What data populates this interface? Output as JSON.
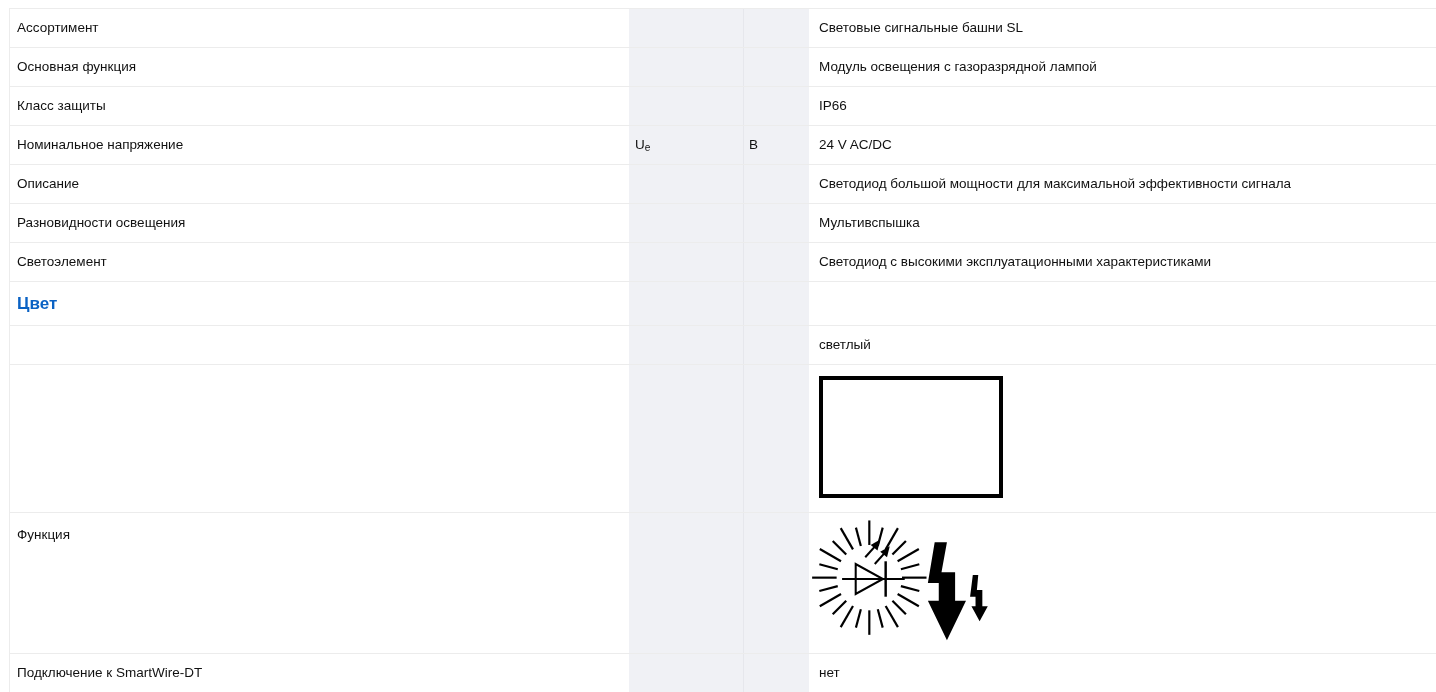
{
  "rows": [
    {
      "kind": "text",
      "label": "Ассортимент",
      "value": "Световые сигнальные башни SL"
    },
    {
      "kind": "text",
      "label": "Основная функция",
      "value": "Модуль освещения с газоразрядной лампой"
    },
    {
      "kind": "text",
      "label": "Класс защиты",
      "value": "IP66"
    },
    {
      "kind": "text",
      "label": "Номинальное напряжение",
      "symbol": "U$_{e}$",
      "unit": "В",
      "value": "24 V AC/DC"
    },
    {
      "kind": "text",
      "label": "Описание",
      "value": "Светодиод большой мощности для максимальной эффективности сигнала"
    },
    {
      "kind": "text",
      "label": "Разновидности освещения",
      "value": "Мультивспышка"
    },
    {
      "kind": "text",
      "label": "Светоэлемент",
      "value": "Светодиод с высокими эксплуатационными характеристиками"
    },
    {
      "kind": "heading",
      "label": "Цвет"
    },
    {
      "kind": "text",
      "value": "светлый"
    },
    {
      "kind": "swatch"
    },
    {
      "kind": "function-symbol",
      "label": "Функция"
    },
    {
      "kind": "text",
      "label": "Подключение к SmartWire-DT",
      "value": "нет"
    }
  ]
}
